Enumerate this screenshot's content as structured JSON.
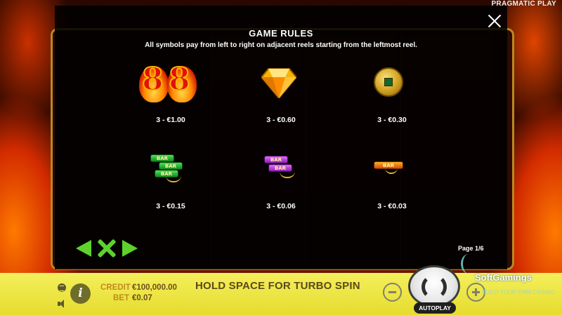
{
  "provider": "PRAGMATIC PLAY",
  "paytable": {
    "title": "GAME RULES",
    "description": "All symbols pay from left to right on adjacent reels starting from the leftmost reel.",
    "symbols": [
      {
        "name": "flaming-88",
        "pay": "3 - €1.00"
      },
      {
        "name": "gold-diamond",
        "pay": "3 - €0.60"
      },
      {
        "name": "jade-coin",
        "pay": "3 - €0.30"
      },
      {
        "name": "triple-bar",
        "pay": "3 - €0.15",
        "bars": [
          "BAR",
          "BAR",
          "BAR"
        ]
      },
      {
        "name": "double-bar",
        "pay": "3 - €0.06",
        "bars": [
          "BAR",
          "BAR"
        ]
      },
      {
        "name": "single-bar",
        "pay": "3 - €0.03",
        "bars": [
          "BAR"
        ]
      }
    ],
    "digits": [
      "8",
      "8"
    ],
    "page": "Page 1/6"
  },
  "bottom_bar": {
    "credit_label": "CREDIT",
    "credit_value": "€100,000.00",
    "bet_label": "BET",
    "bet_value": "€0.07",
    "message": "HOLD SPACE FOR TURBO SPIN",
    "info_label": "i",
    "autoplay_label": "AUTOPLAY"
  },
  "watermark": {
    "name": "SoftGamings",
    "tagline": "BUILD YOUR OWN CASINO"
  },
  "colors": {
    "accent_green": "#5ed22c",
    "bar_yellow": "#f4ef5c",
    "label_gold": "#c08a1e"
  }
}
